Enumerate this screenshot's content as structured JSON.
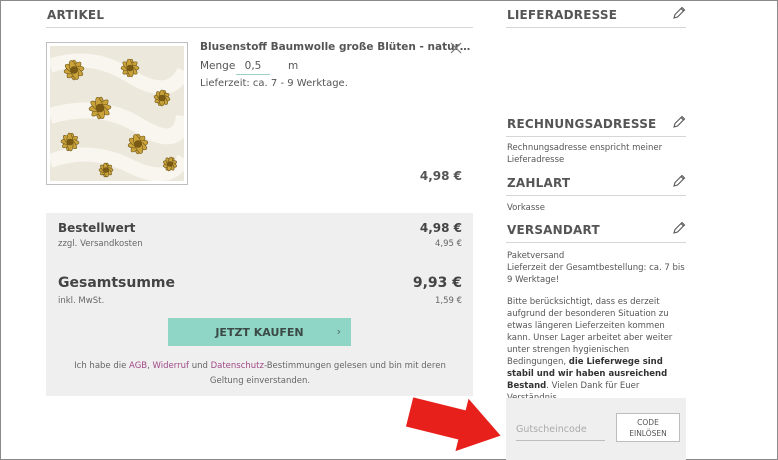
{
  "cart": {
    "heading": "ARTIKEL",
    "item": {
      "name": "Blusenstoff Baumwolle große Blüten - natur…",
      "quantity_label": "Menge",
      "quantity_value": "0,5",
      "unit": "m",
      "delivery": "Lieferzeit: ca. 7 - 9 Werktage.",
      "price": "4,98 €",
      "image_icon": "fabric-flower-image",
      "remove_icon": "close-icon"
    }
  },
  "summary": {
    "order_value_label": "Bestellwert",
    "order_value": "4,98 €",
    "shipping_label": "zzgl. Versandkosten",
    "shipping_value": "4,95 €",
    "total_label": "Gesamtsumme",
    "total_value": "9,93 €",
    "vat_label": "inkl. MwSt.",
    "vat_value": "1,59 €",
    "buy_label": "JETZT KAUFEN",
    "buy_icon": "chevron-right-icon",
    "terms_before": "Ich habe die",
    "terms_agb": "AGB",
    "terms_sep1": ",",
    "terms_widerruf": "Widerruf",
    "terms_and": "und",
    "terms_datenschutz": "Datenschutz",
    "terms_after": "-Bestimmungen gelesen und bin mit deren Geltung einverstanden."
  },
  "sidebar": {
    "delivery_address": {
      "title": "LIEFERADRESSE",
      "edit_icon": "pencil-icon"
    },
    "billing_address": {
      "title": "RECHNUNGSADRESSE",
      "text": "Rechnungsadresse enspricht meiner Lieferadresse"
    },
    "payment": {
      "title": "ZAHLART",
      "text": "Vorkasse"
    },
    "shipping": {
      "title": "VERSANDART",
      "line1": "Paketversand",
      "line2": "Lieferzeit der Gesamtbestellung: ca. 7 bis 9 Werktage!",
      "notice_normal": "Bitte berücksichtigt, dass es derzeit aufgrund der besonderen Situation zu etwas längeren Lieferzeiten kommen kann. Unser Lager arbeitet aber weiter unter strengen hygienischen Bedingungen,",
      "notice_bold": "die Lieferwege sind stabil und wir haben ausreichend Bestand",
      "notice_end": ". Vielen Dank für Euer Verständnis."
    },
    "coupon": {
      "placeholder": "Gutscheincode",
      "button_line1": "CODE",
      "button_line2": "EINLÖSEN"
    }
  },
  "annotation": {
    "arrow_icon": "red-arrow-icon",
    "color": "#e8201c"
  },
  "colors": {
    "accent": "#8fd6c6",
    "link": "#a04a86",
    "panel": "#efefef"
  }
}
